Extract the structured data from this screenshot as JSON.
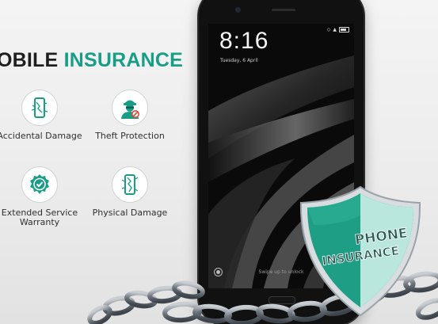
{
  "banner": {
    "title_part1": "OBILE",
    "title_part2": "INSURANCE",
    "features": [
      {
        "label": "Accidental Damage",
        "icon": "cracked-phone-icon"
      },
      {
        "label": "Theft Protection",
        "icon": "thief-icon"
      },
      {
        "label": "Extended Service\nWarranty",
        "icon": "warranty-badge-icon"
      },
      {
        "label": "Physical Damage",
        "icon": "broken-phone-icon"
      }
    ],
    "accent_color": "#1a9d86"
  },
  "phone": {
    "time": "8:16",
    "date": "Tuesday, 6 April",
    "unlock_hint": "Swipe up to unlock"
  },
  "shield": {
    "line1": "PHONE",
    "line2": "INSURANCE"
  }
}
